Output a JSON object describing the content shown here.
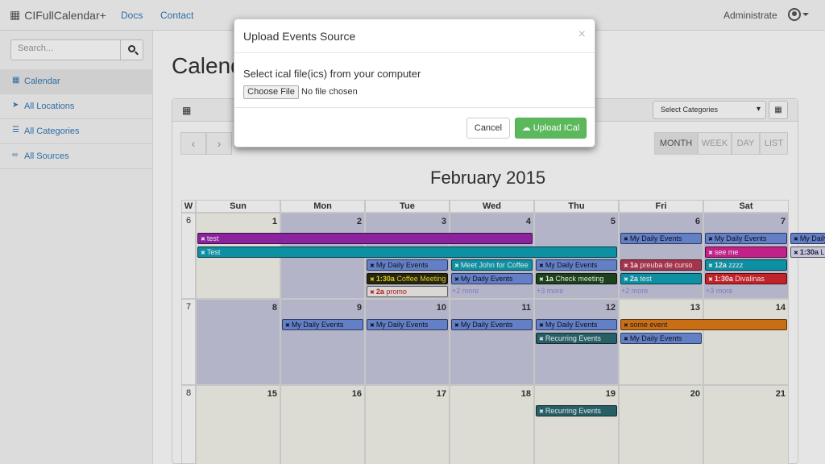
{
  "navbar": {
    "brand": "CIFullCalendar+",
    "docs": "Docs",
    "contact": "Contact",
    "admin": "Administrate"
  },
  "sidebar": {
    "search_placeholder": "Search...",
    "items": [
      {
        "label": "Calendar",
        "icon": "calendar-icon"
      },
      {
        "label": "All Locations",
        "icon": "location-arrow-icon"
      },
      {
        "label": "All Categories",
        "icon": "list-icon"
      },
      {
        "label": "All Sources",
        "icon": "link-icon"
      }
    ]
  },
  "main": {
    "title": "Calendar",
    "select_categories": "Select Categories"
  },
  "calendar": {
    "month_title": "February 2015",
    "views": [
      "MONTH",
      "WEEK",
      "DAY",
      "LIST"
    ],
    "headers": [
      "W",
      "Sun",
      "Mon",
      "Tue",
      "Wed",
      "Thu",
      "Fri",
      "Sat"
    ],
    "weeks": [
      {
        "num": "6",
        "days": [
          "1",
          "2",
          "3",
          "4",
          "5",
          "6",
          "7"
        ]
      },
      {
        "num": "7",
        "days": [
          "8",
          "9",
          "10",
          "11",
          "12",
          "13",
          "14"
        ]
      },
      {
        "num": "8",
        "days": [
          "15",
          "16",
          "17",
          "18",
          "19",
          "20",
          "21"
        ]
      }
    ],
    "events": [
      {
        "row": 0,
        "slot": 0,
        "start": 0,
        "span": 4,
        "time": "",
        "label": "test",
        "bg": "#9b27b0",
        "fg": "#fff"
      },
      {
        "row": 0,
        "slot": 0,
        "start": 5,
        "span": 1,
        "time": "",
        "label": "My Daily Events",
        "bg": "#6f8fdd",
        "fg": "#112"
      },
      {
        "row": 0,
        "slot": 0,
        "start": 6,
        "span": 1,
        "time": "",
        "label": "My Daily Events",
        "bg": "#6f8fdd",
        "fg": "#112"
      },
      {
        "row": 0,
        "slot": 0,
        "start": 7,
        "span": 1,
        "time": "",
        "label": "My Daily Events",
        "bg": "#6f8fdd",
        "fg": "#112"
      },
      {
        "row": 0,
        "slot": 1,
        "start": 0,
        "span": 5,
        "time": "",
        "label": "Test",
        "bg": "#0fa1b5",
        "fg": "#fff"
      },
      {
        "row": 0,
        "slot": 1,
        "start": 6,
        "span": 1,
        "time": "",
        "label": "see me",
        "bg": "#d8259a",
        "fg": "#fff"
      },
      {
        "row": 0,
        "slot": 1,
        "start": 7,
        "span": 1,
        "time": "1:30a",
        "label": "LUKE",
        "bg": "#dcdcf0",
        "fg": "#224"
      },
      {
        "row": 0,
        "slot": 2,
        "start": 2,
        "span": 1,
        "time": "",
        "label": "My Daily Events",
        "bg": "#6f8fdd",
        "fg": "#112"
      },
      {
        "row": 0,
        "slot": 2,
        "start": 3,
        "span": 1,
        "time": "",
        "label": "Meet John for Coffee",
        "bg": "#0fa1b5",
        "fg": "#fff"
      },
      {
        "row": 0,
        "slot": 2,
        "start": 4,
        "span": 1,
        "time": "",
        "label": "My Daily Events",
        "bg": "#6f8fdd",
        "fg": "#112"
      },
      {
        "row": 0,
        "slot": 2,
        "start": 5,
        "span": 1,
        "time": "1a",
        "label": "preuba de curso",
        "bg": "#b93a54",
        "fg": "#fff"
      },
      {
        "row": 0,
        "slot": 2,
        "start": 6,
        "span": 1,
        "time": "12a",
        "label": "zzzz",
        "bg": "#0fa1b5",
        "fg": "#fff"
      },
      {
        "row": 0,
        "slot": 3,
        "start": 2,
        "span": 1,
        "time": "1:30a",
        "label": "Coffee Meeting",
        "bg": "#2c2c10",
        "fg": "#f0e030"
      },
      {
        "row": 0,
        "slot": 3,
        "start": 3,
        "span": 1,
        "time": "",
        "label": "My Daily Events",
        "bg": "#6f8fdd",
        "fg": "#112"
      },
      {
        "row": 0,
        "slot": 3,
        "start": 4,
        "span": 1,
        "time": "1a",
        "label": "Check meeting",
        "bg": "#1f4a1f",
        "fg": "#fff"
      },
      {
        "row": 0,
        "slot": 3,
        "start": 5,
        "span": 1,
        "time": "2a",
        "label": "test",
        "bg": "#0fa1b5",
        "fg": "#fff"
      },
      {
        "row": 0,
        "slot": 3,
        "start": 6,
        "span": 1,
        "time": "1:30a",
        "label": "Divalinas",
        "bg": "#d9262e",
        "fg": "#fff"
      },
      {
        "row": 0,
        "slot": 4,
        "start": 2,
        "span": 1,
        "time": "2a",
        "label": "promo",
        "bg": "#f3f0ee",
        "fg": "#b22"
      },
      {
        "row": 1,
        "slot": 0,
        "start": 1,
        "span": 1,
        "time": "",
        "label": "My Daily Events",
        "bg": "#6f8fdd",
        "fg": "#112"
      },
      {
        "row": 1,
        "slot": 0,
        "start": 2,
        "span": 1,
        "time": "",
        "label": "My Daily Events",
        "bg": "#6f8fdd",
        "fg": "#112"
      },
      {
        "row": 1,
        "slot": 0,
        "start": 3,
        "span": 1,
        "time": "",
        "label": "My Daily Events",
        "bg": "#6f8fdd",
        "fg": "#112"
      },
      {
        "row": 1,
        "slot": 0,
        "start": 4,
        "span": 1,
        "time": "",
        "label": "My Daily Events",
        "bg": "#6f8fdd",
        "fg": "#112"
      },
      {
        "row": 1,
        "slot": 0,
        "start": 5,
        "span": 2,
        "time": "",
        "label": "some event",
        "bg": "#e07b18",
        "fg": "#222"
      },
      {
        "row": 1,
        "slot": 1,
        "start": 4,
        "span": 1,
        "time": "",
        "label": "Recurring Events",
        "bg": "#2c6a73",
        "fg": "#fff"
      },
      {
        "row": 1,
        "slot": 1,
        "start": 5,
        "span": 1,
        "time": "",
        "label": "My Daily Events",
        "bg": "#6f8fdd",
        "fg": "#112"
      },
      {
        "row": 2,
        "slot": 0,
        "start": 4,
        "span": 1,
        "time": "",
        "label": "Recurring Events",
        "bg": "#2c6a73",
        "fg": "#fff"
      }
    ],
    "more": [
      {
        "row": 0,
        "col": 3,
        "label": "+2 more"
      },
      {
        "row": 0,
        "col": 4,
        "label": "+3 more"
      },
      {
        "row": 0,
        "col": 5,
        "label": "+2 more"
      },
      {
        "row": 0,
        "col": 6,
        "label": "+3 more"
      }
    ]
  },
  "modal": {
    "title": "Upload Events Source",
    "close": "×",
    "label": "Select ical file(ics) from your computer",
    "choose": "Choose File",
    "no_file": "No file chosen",
    "cancel": "Cancel",
    "upload": "Upload ICal"
  }
}
